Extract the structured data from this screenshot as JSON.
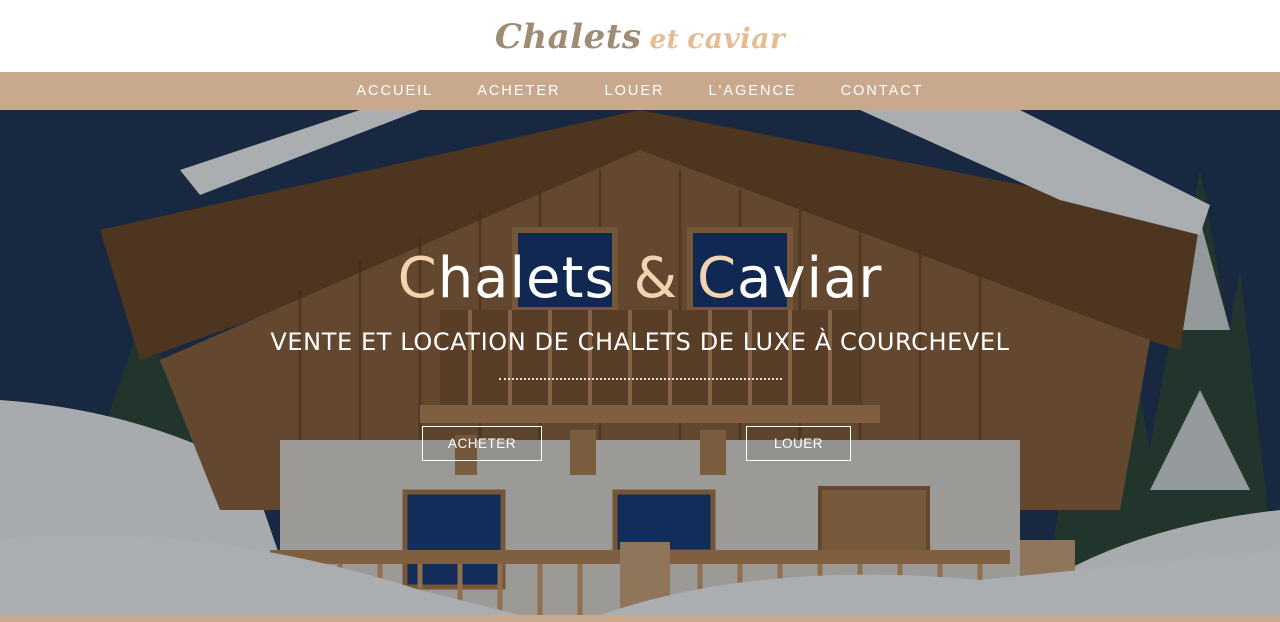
{
  "header": {
    "logo_word1": "Chalets",
    "logo_word2": "et",
    "logo_word3": "caviar"
  },
  "nav": {
    "items": [
      {
        "label": "ACCUEIL"
      },
      {
        "label": "ACHETER"
      },
      {
        "label": "LOUER"
      },
      {
        "label": "L'AGENCE"
      },
      {
        "label": "CONTACT"
      }
    ]
  },
  "hero": {
    "title_part1_initial": "C",
    "title_part1_rest": "halets ",
    "title_amp": "&",
    "title_part2_initial": "C",
    "title_part2_rest": "aviar",
    "subtitle": "VENTE ET LOCATION DE CHALETS DE LUXE À COURCHEVEL",
    "buttons": {
      "buy": "ACHETER",
      "rent": "LOUER"
    },
    "image_subject": "snow-covered-wooden-chalet"
  },
  "colors": {
    "nav_background": "#c8a98d",
    "logo_dark": "#a08b74",
    "logo_light": "#e6bd92",
    "title_accent": "#f3d3b0",
    "text_white": "#ffffff"
  }
}
